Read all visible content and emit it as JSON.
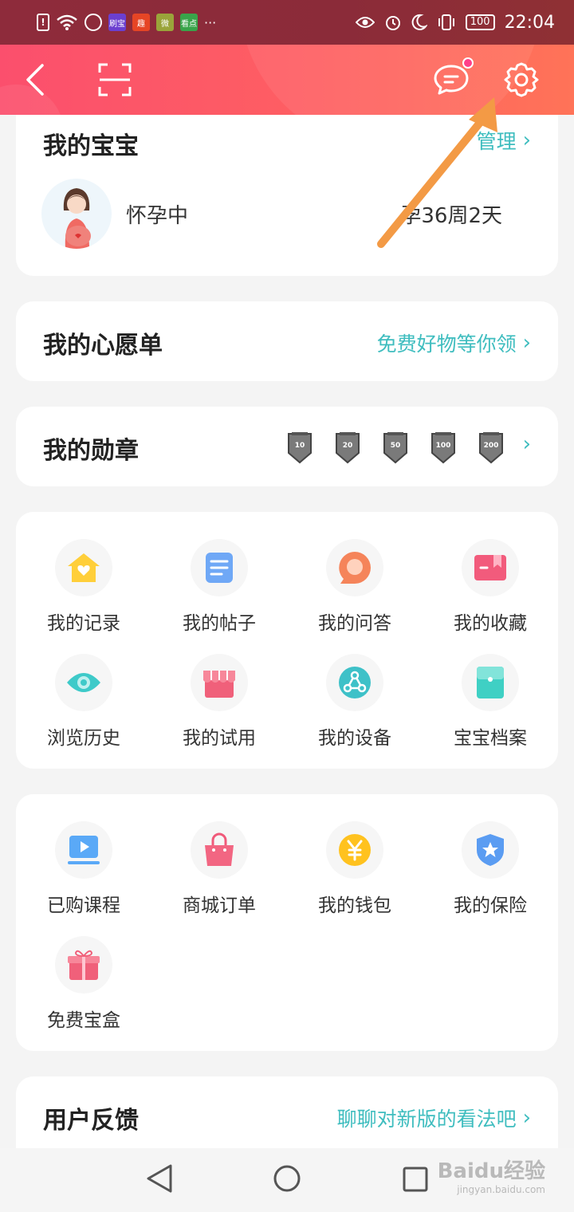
{
  "status_bar": {
    "app_icons": [
      "刷宝",
      "趣",
      "微",
      "看点"
    ],
    "more": "···",
    "battery": "100",
    "time": "22:04"
  },
  "header": {
    "back_icon": "chevron-left-icon",
    "scan_icon": "scan-icon",
    "message_icon": "chat-bubble-icon",
    "settings_icon": "gear-icon"
  },
  "baby_card": {
    "title": "我的宝宝",
    "manage_label": "管理",
    "status": "怀孕中",
    "pregnancy": "孕36周2天"
  },
  "wishlist": {
    "title": "我的心愿单",
    "link": "免费好物等你领"
  },
  "medals": {
    "title": "我的勋章",
    "items": [
      "10",
      "20",
      "50",
      "100",
      "200"
    ]
  },
  "features_1": [
    {
      "label": "我的记录",
      "icon": "home-heart-icon"
    },
    {
      "label": "我的帖子",
      "icon": "document-icon"
    },
    {
      "label": "我的问答",
      "icon": "qa-bubble-icon"
    },
    {
      "label": "我的收藏",
      "icon": "bookmark-icon"
    },
    {
      "label": "浏览历史",
      "icon": "eye-icon"
    },
    {
      "label": "我的试用",
      "icon": "shop-icon"
    },
    {
      "label": "我的设备",
      "icon": "device-icon"
    },
    {
      "label": "宝宝档案",
      "icon": "folder-icon"
    }
  ],
  "features_2": [
    {
      "label": "已购课程",
      "icon": "video-icon"
    },
    {
      "label": "商城订单",
      "icon": "shopping-bag-icon"
    },
    {
      "label": "我的钱包",
      "icon": "yen-coin-icon"
    },
    {
      "label": "我的保险",
      "icon": "shield-star-icon"
    },
    {
      "label": "免费宝盒",
      "icon": "gift-icon"
    }
  ],
  "feedback": {
    "title": "用户反馈",
    "link": "聊聊对新版的看法吧"
  },
  "watermark": {
    "brand": "Baidu经验",
    "url": "jingyan.baidu.com"
  },
  "colors": {
    "accent_teal": "#3fbdbf",
    "header_start": "#fb4f6d",
    "header_end": "#ff7358",
    "annotation_arrow": "#f39a45"
  }
}
